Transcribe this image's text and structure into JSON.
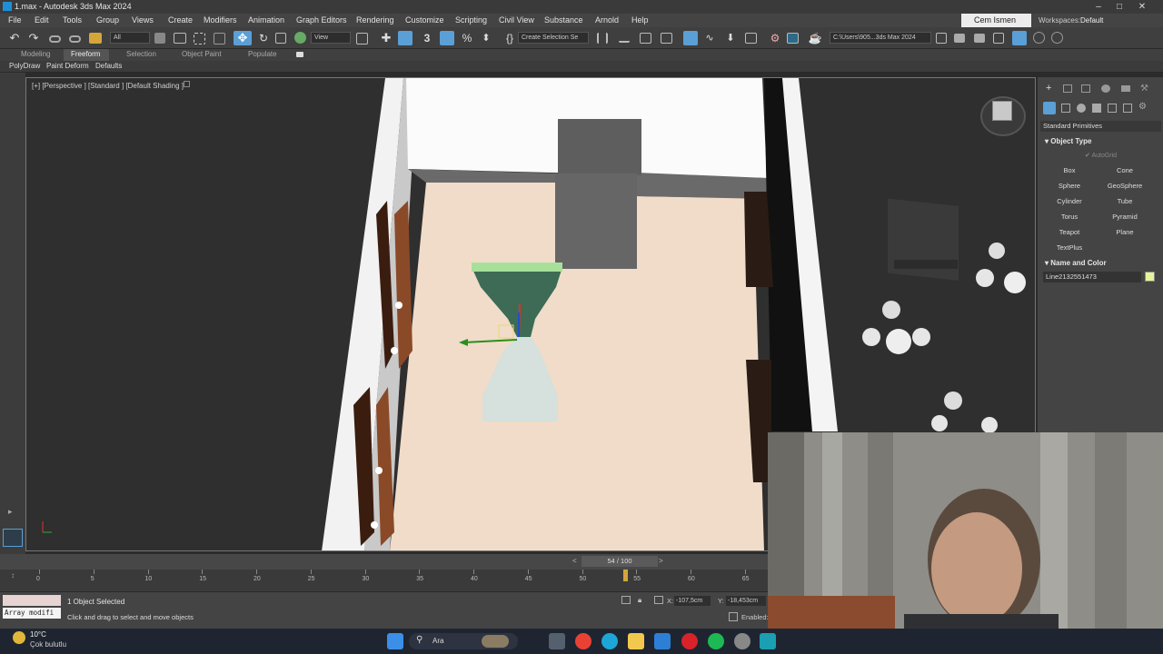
{
  "window": {
    "title": "1.max - Autodesk 3ds Max 2024",
    "controls": [
      "–",
      "□",
      "✕"
    ]
  },
  "menu": [
    "File",
    "Edit",
    "Tools",
    "Group",
    "Views",
    "Create",
    "Modifiers",
    "Animation",
    "Graph Editors",
    "Rendering",
    "Customize",
    "Scripting",
    "Civil View",
    "Substance",
    "Arnold",
    "Help"
  ],
  "user": {
    "name": "Cem Ismen",
    "workspaces_label": "Workspaces:",
    "workspace": "Default"
  },
  "toolbar": {
    "filter": "All",
    "view": "View",
    "selection_set": "Create Selection Se",
    "path": "C:\\Users\\905...3ds Max 2024"
  },
  "ribbon": {
    "tabs": [
      "Modeling",
      "Freeform",
      "Selection",
      "Object Paint",
      "Populate"
    ],
    "active": "Freeform",
    "subtabs": [
      "PolyDraw",
      "Paint Deform",
      "Defaults"
    ]
  },
  "viewport": {
    "label": "[+] [Perspective ] [Standard ] [Default Shading ]"
  },
  "command_panel": {
    "dropdown": "Standard Primitives",
    "object_type_title": "Object Type",
    "autogrid": "AutoGrid",
    "buttons": [
      "Box",
      "Cone",
      "Sphere",
      "GeoSphere",
      "Cylinder",
      "Tube",
      "Torus",
      "Pyramid",
      "Teapot",
      "Plane",
      "TextPlus"
    ],
    "name_color_title": "Name and Color",
    "object_name": "Line2132551473",
    "object_color": "#e6f59a"
  },
  "timeline": {
    "frame": "54 / 100",
    "ticks": [
      "0",
      "5",
      "10",
      "15",
      "20",
      "25",
      "30",
      "35",
      "40",
      "45",
      "50",
      "55",
      "60",
      "65"
    ],
    "current": 54
  },
  "status": {
    "modifier_box": "Array modifi",
    "selected": "1 Object Selected",
    "prompt": "Click and drag to select and move objects",
    "x_label": "X:",
    "x": "-107,5cm",
    "y_label": "Y:",
    "y": "-18,453cm",
    "enabled": "Enabled:"
  },
  "taskbar": {
    "temp": "10°C",
    "weather": "Çok bulutlu",
    "search": "Ara"
  },
  "colors": {
    "accent": "#5a9fd6",
    "ui_bg": "#444444",
    "floor": "#f0dcc9",
    "object_top": "#3d6b55",
    "object_bottom": "#d6e0dc"
  }
}
